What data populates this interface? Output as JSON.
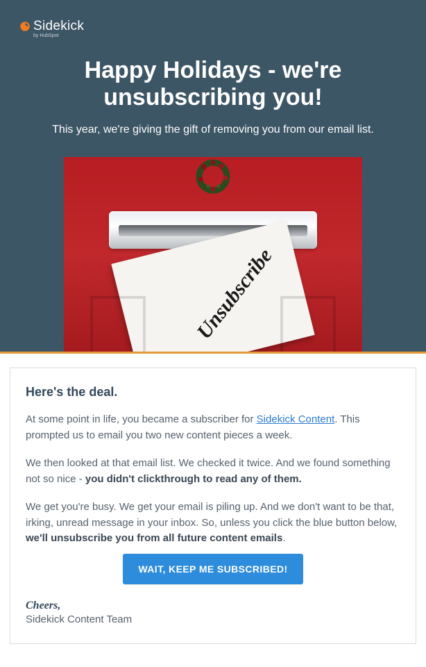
{
  "logo": {
    "brand": "Sidekick",
    "byline": "by HubSpot"
  },
  "hero": {
    "title": "Happy Holidays - we're unsubscribing you!",
    "subtitle": "This year, we're giving the gift of removing you from our email list.",
    "envelope_text": "Unsubscribe"
  },
  "card": {
    "heading": "Here's the deal.",
    "p1_before": "At some point in life, you became a subscriber for ",
    "p1_link": "Sidekick Content",
    "p1_after": ". This prompted us to email you two new content pieces a week.",
    "p2_before": "We then looked at that email list. We checked it twice. And we found something not so nice - ",
    "p2_bold": "you didn't clickthrough to read any of them.",
    "p3_before": "We get you're busy. We get your email is piling up. And we don't want to be that, irking, unread message in your inbox. So, unless you click the blue button below, ",
    "p3_bold": "we'll unsubscribe you from all future content emails",
    "p3_after": ".",
    "cta": "WAIT, KEEP ME SUBSCRIBED!",
    "signoff": "Cheers,",
    "team": "Sidekick Content Team"
  },
  "colors": {
    "hero_bg": "#3d5666",
    "accent_border": "#e79a3a",
    "cta_bg": "#2d8cdc",
    "link": "#2b7bd1"
  }
}
